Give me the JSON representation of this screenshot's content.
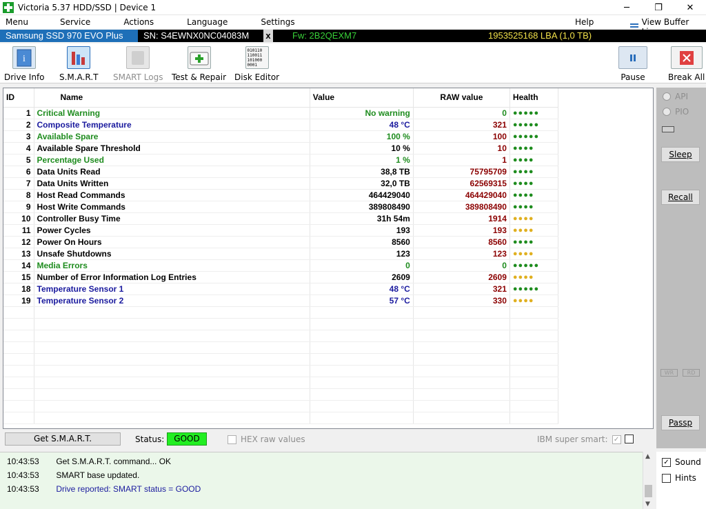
{
  "window": {
    "title": "Victoria 5.37 HDD/SSD | Device 1",
    "minimize": "─",
    "maximize": "❐",
    "close": "✕"
  },
  "menu": {
    "items": [
      "Menu",
      "Service",
      "Actions",
      "Language",
      "Settings"
    ],
    "help": "Help",
    "view_buffer": "View Buffer Live"
  },
  "drive": {
    "model": "Samsung SSD 970 EVO Plus 1TB",
    "sn": "SN: S4EWNX0NC04083M",
    "close": "x",
    "fw": "Fw: 2B2QEXM7",
    "lba": "1953525168 LBA (1,0 TB)"
  },
  "toolbar": {
    "drive_info": "Drive Info",
    "smart": "S.M.A.R.T",
    "smart_logs": "SMART Logs",
    "test_repair": "Test & Repair",
    "disk_editor": "Disk Editor",
    "pause": "Pause",
    "break_all": "Break All",
    "disk_editor_icon_text": "010110 110011 101000 0001"
  },
  "table": {
    "headers": {
      "id": "ID",
      "name": "Name",
      "value": "Value",
      "raw": "RAW value",
      "health": "Health"
    },
    "rows": [
      {
        "id": "1",
        "name": "Critical Warning",
        "value": "No warning",
        "raw": "0",
        "health": "●●●●●",
        "nc": "ok",
        "vc": "ok",
        "rc": "raw-ok",
        "hc": "dots-g"
      },
      {
        "id": "2",
        "name": "Composite Temperature",
        "value": "48 °C",
        "raw": "321",
        "health": "●●●●●",
        "nc": "blue",
        "vc": "blue",
        "rc": "raw-red",
        "hc": "dots-g"
      },
      {
        "id": "3",
        "name": "Available Spare",
        "value": "100 %",
        "raw": "100",
        "health": "●●●●●",
        "nc": "ok",
        "vc": "ok",
        "rc": "raw-red",
        "hc": "dots-g"
      },
      {
        "id": "4",
        "name": "Available Spare Threshold",
        "value": "10 %",
        "raw": "10",
        "health": "●●●●",
        "nc": "blk",
        "vc": "blk",
        "rc": "raw-red",
        "hc": "dots-g"
      },
      {
        "id": "5",
        "name": "Percentage Used",
        "value": "1 %",
        "raw": "1",
        "health": "●●●●",
        "nc": "ok",
        "vc": "ok",
        "rc": "raw-red",
        "hc": "dots-g"
      },
      {
        "id": "6",
        "name": "Data Units Read",
        "value": "38,8 TB",
        "raw": "75795709",
        "health": "●●●●",
        "nc": "blk",
        "vc": "blk",
        "rc": "raw-red",
        "hc": "dots-g"
      },
      {
        "id": "7",
        "name": "Data Units Written",
        "value": "32,0 TB",
        "raw": "62569315",
        "health": "●●●●",
        "nc": "blk",
        "vc": "blk",
        "rc": "raw-red",
        "hc": "dots-g"
      },
      {
        "id": "8",
        "name": "Host Read Commands",
        "value": "464429040",
        "raw": "464429040",
        "health": "●●●●",
        "nc": "blk",
        "vc": "blk",
        "rc": "raw-red",
        "hc": "dots-g"
      },
      {
        "id": "9",
        "name": "Host Write Commands",
        "value": "389808490",
        "raw": "389808490",
        "health": "●●●●",
        "nc": "blk",
        "vc": "blk",
        "rc": "raw-red",
        "hc": "dots-g"
      },
      {
        "id": "10",
        "name": "Controller Busy Time",
        "value": "31h 54m",
        "raw": "1914",
        "health": "●●●●",
        "nc": "blk",
        "vc": "blk",
        "rc": "raw-red",
        "hc": "dots-y"
      },
      {
        "id": "11",
        "name": "Power Cycles",
        "value": "193",
        "raw": "193",
        "health": "●●●●",
        "nc": "blk",
        "vc": "blk",
        "rc": "raw-red",
        "hc": "dots-y"
      },
      {
        "id": "12",
        "name": "Power On Hours",
        "value": "8560",
        "raw": "8560",
        "health": "●●●●",
        "nc": "blk",
        "vc": "blk",
        "rc": "raw-red",
        "hc": "dots-g"
      },
      {
        "id": "13",
        "name": "Unsafe Shutdowns",
        "value": "123",
        "raw": "123",
        "health": "●●●●",
        "nc": "blk",
        "vc": "blk",
        "rc": "raw-red",
        "hc": "dots-y"
      },
      {
        "id": "14",
        "name": "Media Errors",
        "value": "0",
        "raw": "0",
        "health": "●●●●●",
        "nc": "ok",
        "vc": "ok",
        "rc": "raw-ok",
        "hc": "dots-g"
      },
      {
        "id": "15",
        "name": "Number of Error Information Log Entries",
        "value": "2609",
        "raw": "2609",
        "health": "●●●●",
        "nc": "blk",
        "vc": "blk",
        "rc": "raw-red",
        "hc": "dots-y"
      },
      {
        "id": "18",
        "name": "Temperature Sensor 1",
        "value": "48 °C",
        "raw": "321",
        "health": "●●●●●",
        "nc": "blue",
        "vc": "blue",
        "rc": "raw-red",
        "hc": "dots-g"
      },
      {
        "id": "19",
        "name": "Temperature Sensor 2",
        "value": "57 °C",
        "raw": "330",
        "health": "●●●●",
        "nc": "blue",
        "vc": "blue",
        "rc": "raw-red",
        "hc": "dots-y"
      }
    ]
  },
  "status": {
    "get_button": "Get S.M.A.R.T.",
    "label": "Status:",
    "value": "GOOD",
    "hex_label": "HEX raw values",
    "ibm_label": "IBM super smart:",
    "ibm_check": "✓"
  },
  "sidebar": {
    "api": "API",
    "pio": "PIO",
    "sleep": "Sleep",
    "recall": "Recall",
    "wr": "WR",
    "rd": "RD",
    "passp": "Passp"
  },
  "log": [
    {
      "time": "10:43:53",
      "msg": "Get S.M.A.R.T. command... OK"
    },
    {
      "time": "10:43:53",
      "msg": "SMART base updated."
    },
    {
      "time": "10:43:53",
      "msg": "Drive reported: SMART status = GOOD"
    }
  ],
  "options": {
    "sound": "Sound",
    "hints": "Hints",
    "check": "✓"
  },
  "colors": {
    "good": "#22ee22",
    "model_bg": "#1e6fb8",
    "fw": "#38d038",
    "lba": "#f0e04a"
  }
}
